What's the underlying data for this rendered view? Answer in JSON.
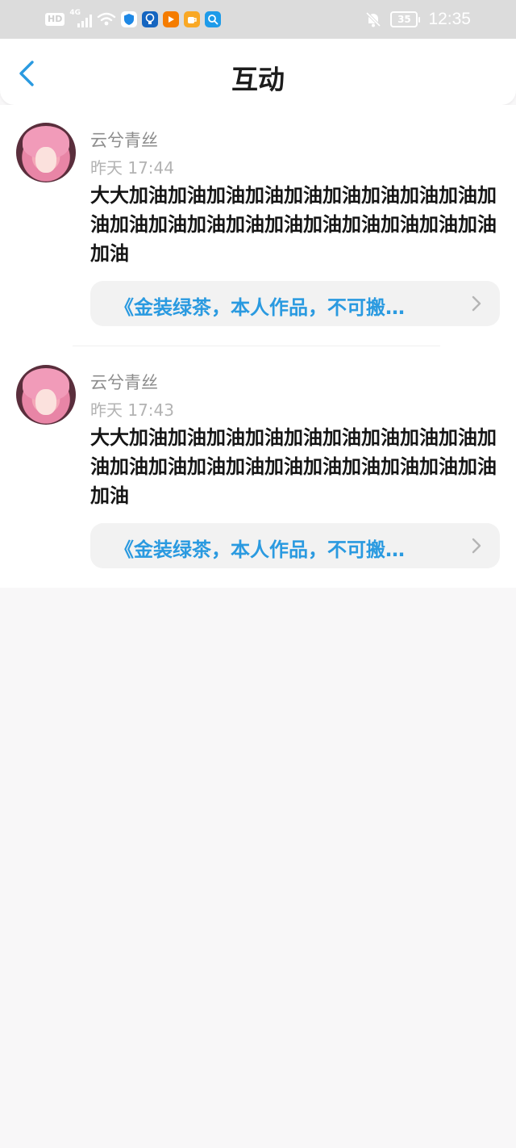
{
  "status_bar": {
    "hd_label": "HD",
    "network_label": "4G",
    "battery_level": "35",
    "time": "12:35",
    "icons": [
      "hd-icon",
      "signal-icon",
      "wifi-icon",
      "shield-app-icon",
      "bulb-app-icon",
      "play-app-icon",
      "cup-app-icon",
      "search-app-icon",
      "bell-muted-icon",
      "battery-icon"
    ]
  },
  "header": {
    "title": "互动",
    "back_icon": "chevron-left-icon"
  },
  "colors": {
    "accent": "#2a9ae0",
    "title": "#1c1c1c",
    "name": "#8d8d8d",
    "time": "#b3b3b3",
    "card_bg": "#f2f2f2"
  },
  "items": [
    {
      "user": "云兮青丝",
      "time": "昨天 17:44",
      "content": "大大加油加油加油加油加油加油加油加油加油加油加油加油加油加油加油加油加油加油加油加油加油",
      "reference": "《金装绿茶，本人作品，不可搬…"
    },
    {
      "user": "云兮青丝",
      "time": "昨天 17:43",
      "content": "大大加油加油加油加油加油加油加油加油加油加油加油加油加油加油加油加油加油加油加油加油加油",
      "reference": "《金装绿茶，本人作品，不可搬…"
    }
  ]
}
